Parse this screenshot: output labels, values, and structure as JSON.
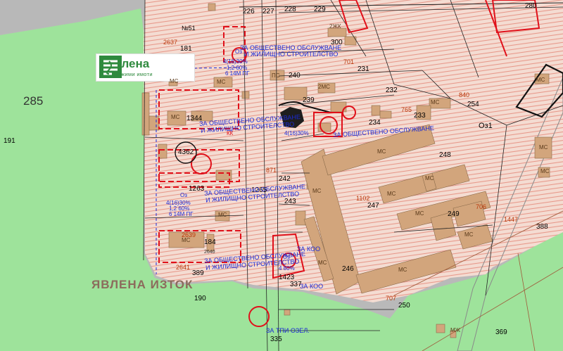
{
  "logo": {
    "name": "Явлена",
    "tagline": "недвижими имоти",
    "color": "#2f8a3e"
  },
  "district_label": "ЯВЛЕНА ИЗТОК",
  "big_parcel": "285",
  "colors": {
    "green_land": "#9ee39b",
    "hatched_base": "#f3d9cf",
    "hatch": "#e89486",
    "building": "#d2a57c",
    "red_line": "#e0101a",
    "blue_text": "#1b2ad6",
    "grey_road": "#b9b9b9"
  },
  "parcels": [
    {
      "text": "226"
    },
    {
      "text": "227"
    },
    {
      "text": "228"
    },
    {
      "text": "229"
    },
    {
      "text": "280"
    },
    {
      "text": "2637"
    },
    {
      "text": "181"
    },
    {
      "text": "№51"
    },
    {
      "text": "300"
    },
    {
      "text": "231"
    },
    {
      "text": "232"
    },
    {
      "text": "233"
    },
    {
      "text": "254"
    },
    {
      "text": "1344"
    },
    {
      "text": "4362"
    },
    {
      "text": "1263"
    },
    {
      "text": "184"
    },
    {
      "text": "2639"
    },
    {
      "text": "389"
    },
    {
      "text": "2641"
    },
    {
      "text": "190"
    },
    {
      "text": "191"
    },
    {
      "text": "242"
    },
    {
      "text": "243"
    },
    {
      "text": "247"
    },
    {
      "text": "248"
    },
    {
      "text": "249"
    },
    {
      "text": "246"
    },
    {
      "text": "250"
    },
    {
      "text": "388"
    },
    {
      "text": "369"
    },
    {
      "text": "335"
    },
    {
      "text": "337"
    },
    {
      "text": "1102"
    },
    {
      "text": "1447"
    },
    {
      "text": "707"
    },
    {
      "text": "706"
    },
    {
      "text": "765"
    },
    {
      "text": "701"
    },
    {
      "text": "840"
    },
    {
      "text": "1265"
    },
    {
      "text": "871"
    },
    {
      "text": "1423"
    },
    {
      "text": "240"
    },
    {
      "text": "239"
    },
    {
      "text": "234"
    },
    {
      "text": "Оз1"
    },
    {
      "text": "2640"
    }
  ],
  "zones": [
    {
      "text": "ЗА ОБЩЕСТВЕНО ОБСЛУЖВАНЕ"
    },
    {
      "text": "И ЖИЛИЩНО СТРОИТЕЛСТВО"
    },
    {
      "text": "ЗА ОБЩЕСТВЕНО ОБСЛУЖВАНЕ"
    },
    {
      "text": "И ЖИЛИЩНО СТРОИТЕЛСТВО"
    },
    {
      "text": "ЗА ОБЩЕСТВЕНО ОБСЛУЖВАНЕ"
    },
    {
      "text": "И ЖИЛИЩНО СТРОИТЕЛСТВО"
    },
    {
      "text": "ЗА ОБЩЕСТВЕНО ОБСЛУЖВАНЕ"
    },
    {
      "text": "И ЖИЛИЩНО СТРОИТЕЛСТВО"
    },
    {
      "text": "ЗА ОБЩЕСТВЕНО ОБСЛУЖВАНЕ"
    },
    {
      "text": "ЗА КОО"
    },
    {
      "text": "ЗА КОО"
    },
    {
      "text": "ЗА ТПИ ОЗЕЛ."
    }
  ],
  "zone_codes": [
    {
      "text": "4(16)30%"
    },
    {
      "text": "1,2 60%"
    },
    {
      "text": "6 14М ПГ"
    },
    {
      "text": "4(16)30%"
    },
    {
      "text": "1,2 60%"
    },
    {
      "text": "6 14М ПГ"
    },
    {
      "text": "4(16)30%"
    },
    {
      "text": "4 80%"
    },
    {
      "text": "КК"
    },
    {
      "text": "Оз"
    },
    {
      "text": "Оз"
    },
    {
      "text": "Оз"
    }
  ],
  "building_labels": [
    "МС",
    "МС",
    "МС",
    "МС",
    "МС",
    "МС",
    "МС",
    "МС",
    "МС",
    "МС",
    "МС",
    "МС",
    "МС",
    "МС",
    "МС",
    "МС",
    "2МС",
    "ПС",
    "МС",
    "2ЖК",
    "МЖ"
  ]
}
